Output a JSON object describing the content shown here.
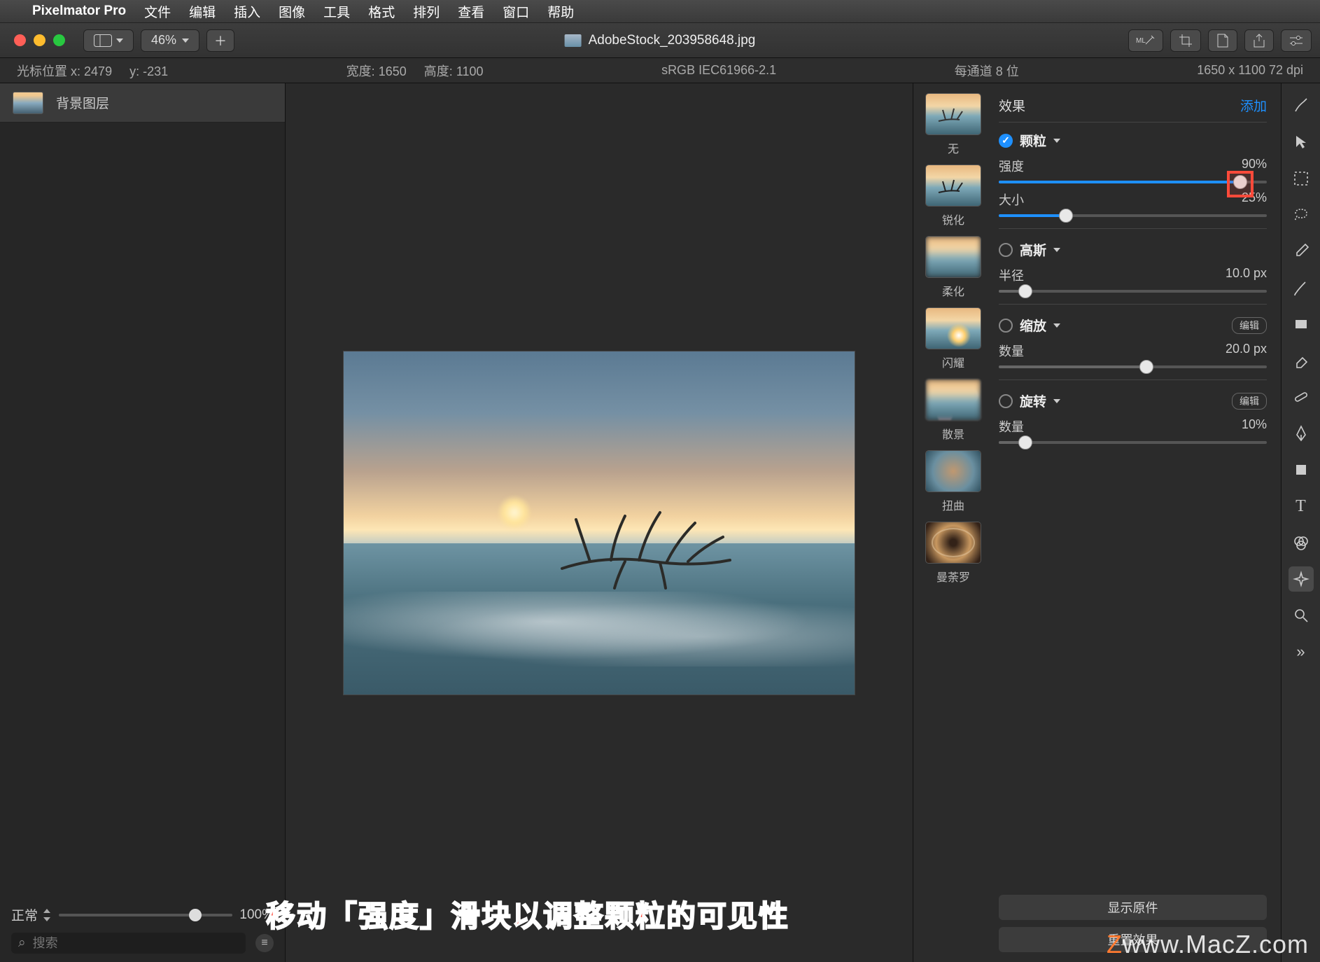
{
  "menubar": {
    "app": "Pixelmator Pro",
    "items": [
      "文件",
      "编辑",
      "插入",
      "图像",
      "工具",
      "格式",
      "排列",
      "查看",
      "窗口",
      "帮助"
    ]
  },
  "toolbar": {
    "zoom": "46%",
    "file_title": "AdobeStock_203958648.jpg"
  },
  "infobar": {
    "cursor_label": "光标位置 x:",
    "cursor_x": "2479",
    "cursor_y_label": "y:",
    "cursor_y": "-231",
    "width_label": "宽度:",
    "width": "1650",
    "height_label": "高度:",
    "height": "1100",
    "color_profile": "sRGB IEC61966-2.1",
    "bit_depth": "每通道 8 位",
    "dimensions": "1650 x 1100 72 dpi"
  },
  "layers": {
    "items": [
      {
        "name": "背景图层"
      }
    ],
    "blend_mode": "正常",
    "opacity": "100%",
    "search_placeholder": "搜索"
  },
  "fx": {
    "header": {
      "title": "效果",
      "add": "添加"
    },
    "presets": [
      "无",
      "锐化",
      "柔化",
      "闪耀",
      "散景",
      "扭曲",
      "曼荼罗"
    ],
    "grain": {
      "title": "颗粒",
      "intensity_label": "强度",
      "intensity_value": "90%",
      "intensity_pct": 90,
      "size_label": "大小",
      "size_value": "25%",
      "size_pct": 25,
      "enabled": true
    },
    "gaussian": {
      "title": "高斯",
      "radius_label": "半径",
      "radius_value": "10.0 px",
      "radius_pct": 10,
      "enabled": false
    },
    "zoom": {
      "title": "缩放",
      "amount_label": "数量",
      "amount_value": "20.0 px",
      "amount_pct": 55,
      "enabled": false,
      "edit": "编辑"
    },
    "spin": {
      "title": "旋转",
      "amount_label": "数量",
      "amount_value": "10%",
      "amount_pct": 10,
      "enabled": false,
      "edit": "编辑"
    },
    "actions": {
      "show_original": "显示原件",
      "reset": "重置效果"
    }
  },
  "annotation": "移动「强度」滑块以调整颗粒的可见性",
  "watermark": {
    "prefix": "",
    "z": "Z",
    "text": "www.MacZ.com"
  }
}
